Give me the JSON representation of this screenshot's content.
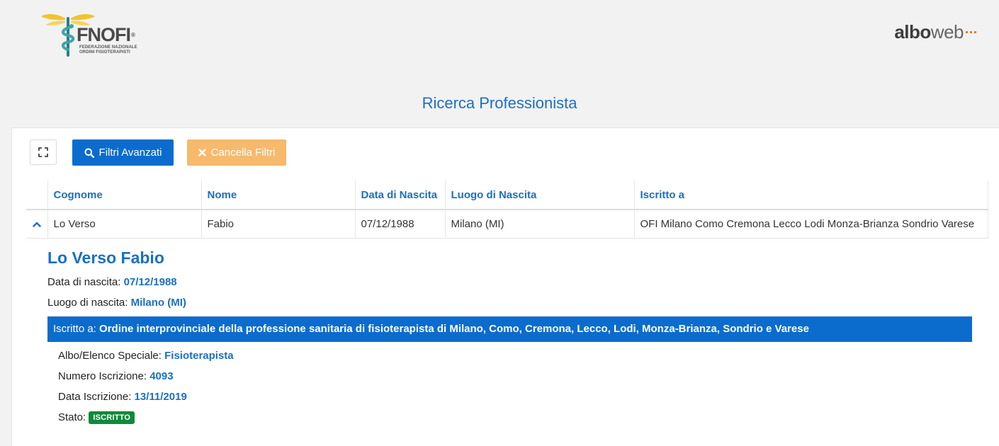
{
  "header": {
    "fnofi_logo": {
      "wordmark": "FNOFI",
      "registered": "®",
      "line1": "FEDERAZIONE NAZIONALE",
      "line2": "ORDINI FISIOTERAPISTI"
    },
    "alboweb_logo": {
      "albo": "albo",
      "web": "web"
    }
  },
  "page_title": "Ricerca Professionista",
  "toolbar": {
    "expand_icon": "expand-icon",
    "filtri_label": "Filtri Avanzati",
    "filtri_icon": "search-icon",
    "cancella_label": "Cancella Filtri",
    "cancella_icon": "times-icon"
  },
  "table": {
    "columns": [
      "Cognome",
      "Nome",
      "Data di Nascita",
      "Luogo di Nascita",
      "Iscritto a"
    ],
    "rows": [
      {
        "cognome": "Lo Verso",
        "nome": "Fabio",
        "data_nascita": "07/12/1988",
        "luogo_nascita": "Milano (MI)",
        "iscritto_a": "OFI Milano Como Cremona Lecco Lodi Monza-Brianza Sondrio Varese"
      }
    ]
  },
  "detail": {
    "full_name": "Lo Verso Fabio",
    "data_nascita_label": "Data di nascita:",
    "data_nascita_value": "07/12/1988",
    "luogo_nascita_label": "Luogo di nascita:",
    "luogo_nascita_value": "Milano (MI)",
    "iscritto_label": "Iscritto a:",
    "iscritto_value": "Ordine interprovinciale della professione sanitaria di fisioterapista di Milano, Como, Cremona, Lecco, Lodi, Monza-Brianza, Sondrio e Varese",
    "albo_label": "Albo/Elenco Speciale:",
    "albo_value": "Fisioterapista",
    "numero_label": "Numero Iscrizione:",
    "numero_value": "4093",
    "data_iscrizione_label": "Data Iscrizione:",
    "data_iscrizione_value": "13/11/2019",
    "stato_label": "Stato:",
    "stato_value": "ISCRITTO"
  },
  "colors": {
    "primary": "#0b6ccd",
    "link": "#1a6fc4",
    "warning": "#f7b96b",
    "success": "#0f8a3c",
    "accent_orange": "#e87722",
    "background": "#f2f2f2"
  }
}
